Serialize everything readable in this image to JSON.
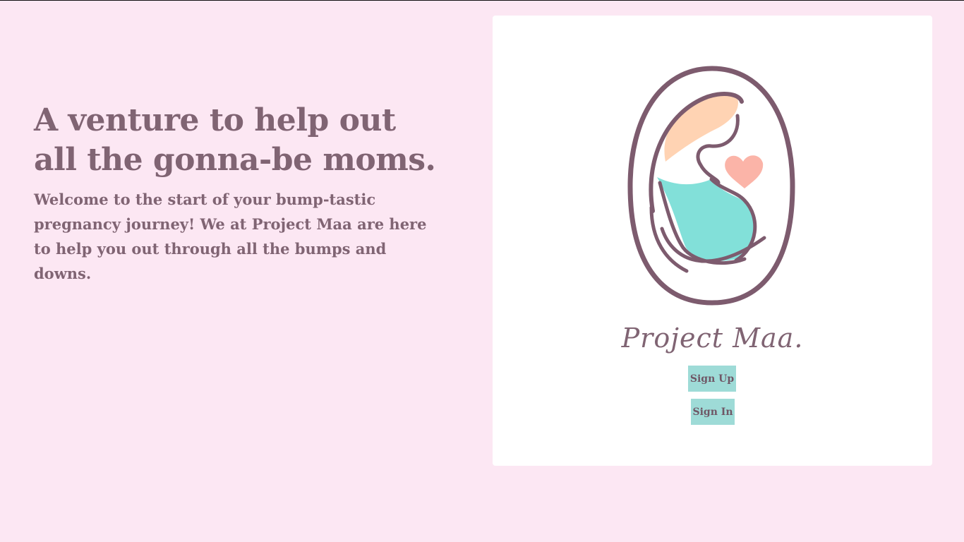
{
  "hero": {
    "title_line1": "A venture to help out",
    "title_line2": "all the gonna-be moms.",
    "text": "Welcome to the start of your bump-tastic pregnancy journey! We at Project Maa are here to help you out through all the bumps and downs."
  },
  "card": {
    "logo_icon": "pregnant-mother-heart-logo",
    "brand_name": "Project Maa.",
    "signup_label": "Sign Up",
    "signin_label": "Sign In"
  },
  "colors": {
    "page_background": "#fce7f3",
    "text": "#806473",
    "button": "#9edbd7",
    "hair": "#ffd3b3",
    "dress": "#82e0d9",
    "heart": "#fbb4a8",
    "outline": "#7d5b6e"
  }
}
